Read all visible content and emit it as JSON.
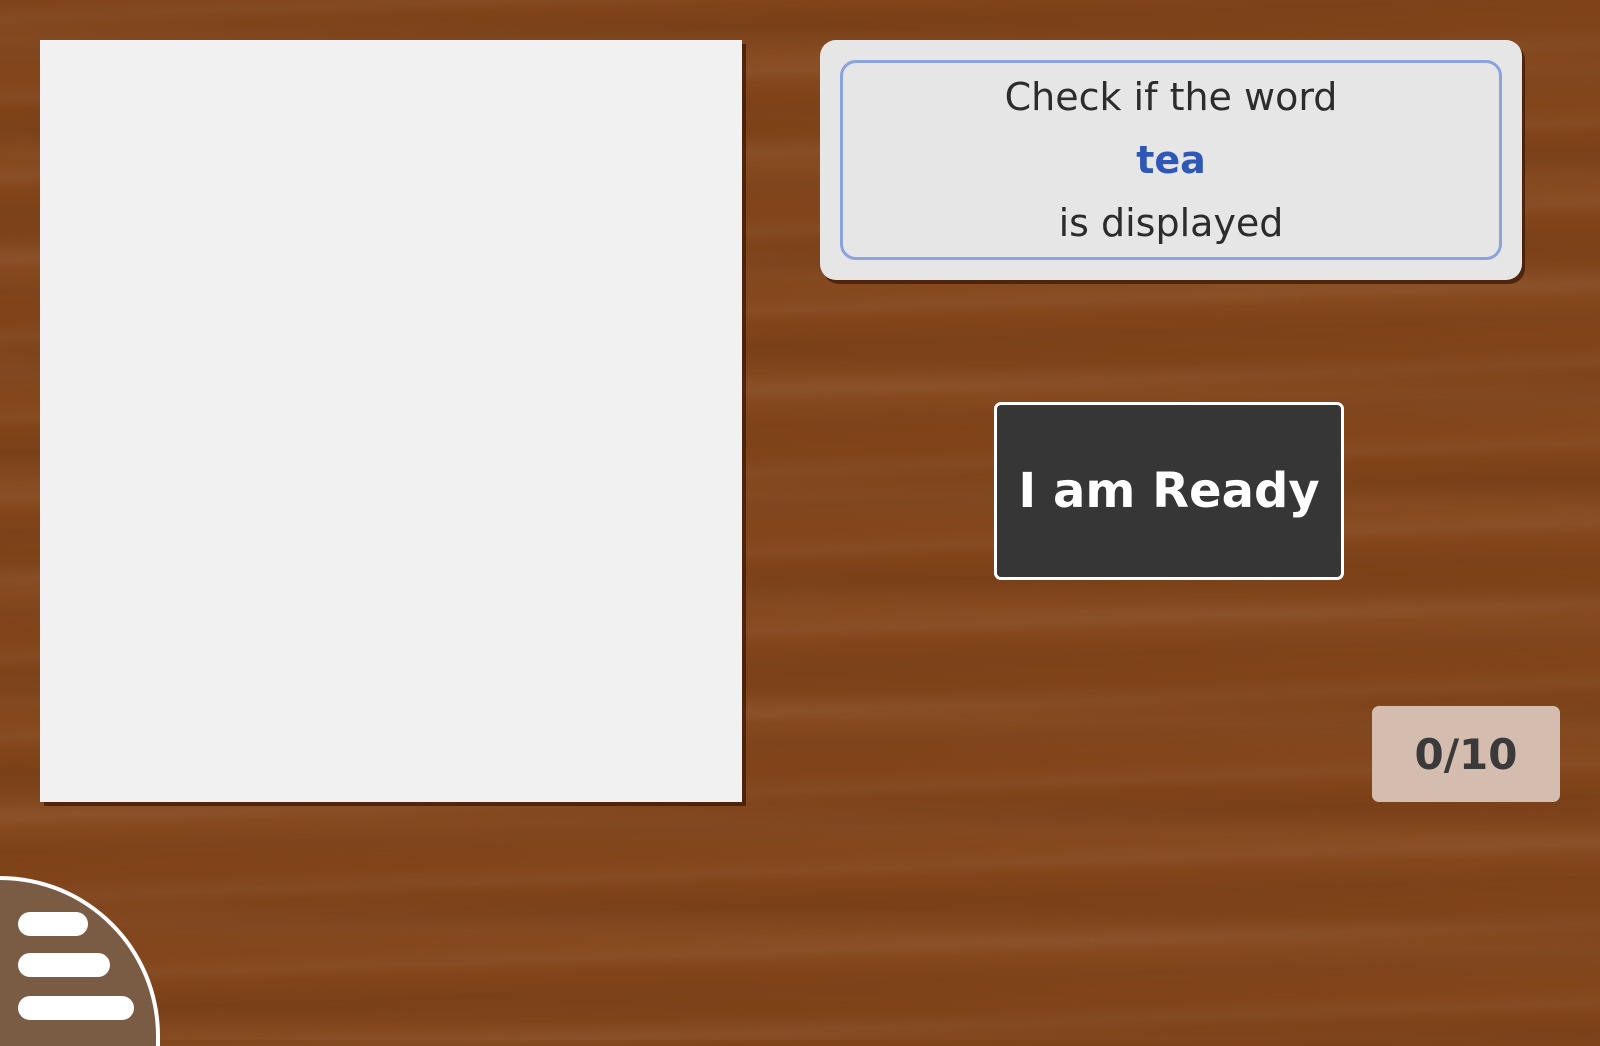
{
  "display_panel": {
    "content": ""
  },
  "instruction": {
    "line1": "Check if the word",
    "word": "tea",
    "line2": "is displayed"
  },
  "ready_button": {
    "label": "I am Ready"
  },
  "score": {
    "text": "0/10",
    "current": 0,
    "total": 10
  },
  "menu": {
    "icon": "hamburger-menu-icon"
  },
  "colors": {
    "background": "#83451a",
    "panel": "#f1f1f1",
    "card": "#e6e6e6",
    "card_border": "#8aa2de",
    "target_word": "#2f57b5",
    "button": "#363636",
    "score_badge": "#d4bcae",
    "menu_button": "#7a5b43"
  }
}
